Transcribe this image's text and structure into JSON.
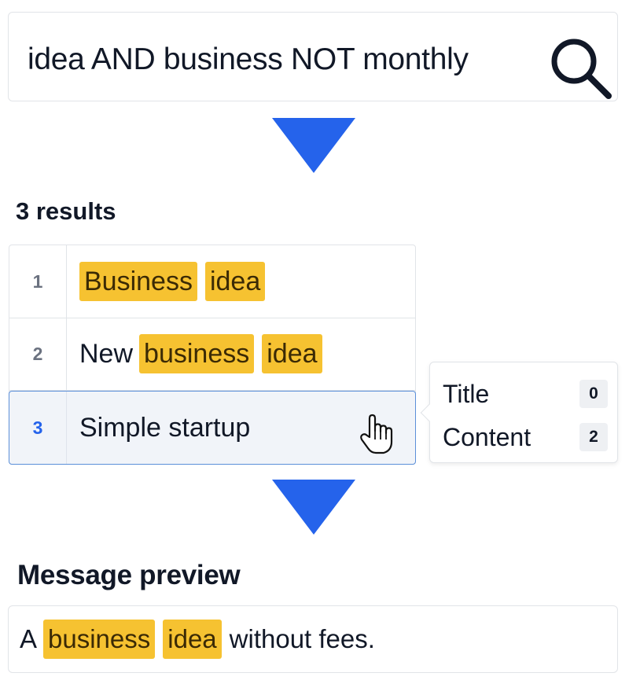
{
  "search": {
    "query": "idea AND business NOT monthly",
    "icon": "search-icon"
  },
  "results": {
    "count_label": "3 results",
    "rows": [
      {
        "num": "1",
        "segments": [
          {
            "text": "Business",
            "highlight": true
          },
          {
            "text": "idea",
            "highlight": true
          }
        ]
      },
      {
        "num": "2",
        "segments": [
          {
            "text": "New",
            "highlight": false
          },
          {
            "text": "business",
            "highlight": true
          },
          {
            "text": "idea",
            "highlight": true
          }
        ]
      },
      {
        "num": "3",
        "segments": [
          {
            "text": "Simple startup",
            "highlight": false
          }
        ],
        "hovered": true
      }
    ]
  },
  "tooltip": {
    "title_label": "Title",
    "title_count": "0",
    "content_label": "Content",
    "content_count": "2"
  },
  "preview": {
    "heading": "Message preview",
    "segments": [
      {
        "text": "A",
        "highlight": false
      },
      {
        "text": "business",
        "highlight": true
      },
      {
        "text": "idea",
        "highlight": true
      },
      {
        "text": "without fees.",
        "highlight": false
      }
    ]
  },
  "colors": {
    "accent_arrow": "#2563eb",
    "highlight": "#f6c231",
    "selected_row_border": "#5b8fd9"
  }
}
